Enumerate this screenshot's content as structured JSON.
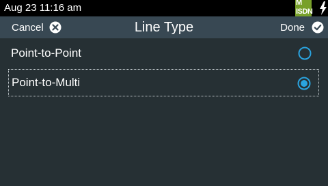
{
  "status": {
    "datetime": "Aug 23 11:16 am",
    "badge_top": "M",
    "badge_bottom": "ISDN"
  },
  "header": {
    "cancel_label": "Cancel",
    "title": "Line Type",
    "done_label": "Done"
  },
  "options": [
    {
      "label": "Point-to-Point",
      "selected": false
    },
    {
      "label": "Point-to-Multi",
      "selected": true
    }
  ],
  "colors": {
    "accent": "#2aa4e0",
    "background": "#263034",
    "header": "#384853",
    "badge": "#78a02a"
  }
}
